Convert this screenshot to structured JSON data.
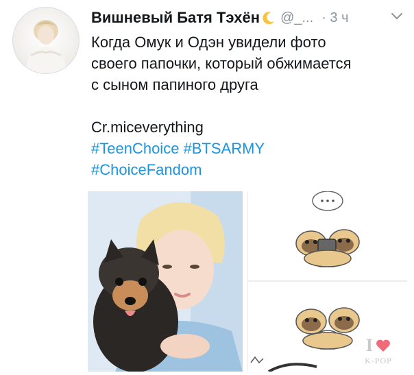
{
  "tweet": {
    "display_name": "Вишневый Батя Тэхён",
    "handle": "@_...",
    "time": "· 3 ч",
    "text_lines": [
      "Когда Омук и Одэн увидели фото",
      "своего папочки, который обжимается",
      "с сыном папиного друга"
    ],
    "credit": "Cr.miceverything",
    "hashtags": [
      "#TeenChoice",
      "#BTSARMY",
      "#ChoiceFandom"
    ]
  },
  "icons": {
    "moon": "crescent-moon-icon",
    "caret": "chevron-down-icon",
    "avatar": "avatar"
  },
  "media": {
    "watermark_letter": "I",
    "watermark_text": "K-POP"
  },
  "colors": {
    "hashtag": "#1b95e0",
    "secondary_text": "#8a939b",
    "moon": "#f5c542",
    "heart": "#f06a7a"
  }
}
